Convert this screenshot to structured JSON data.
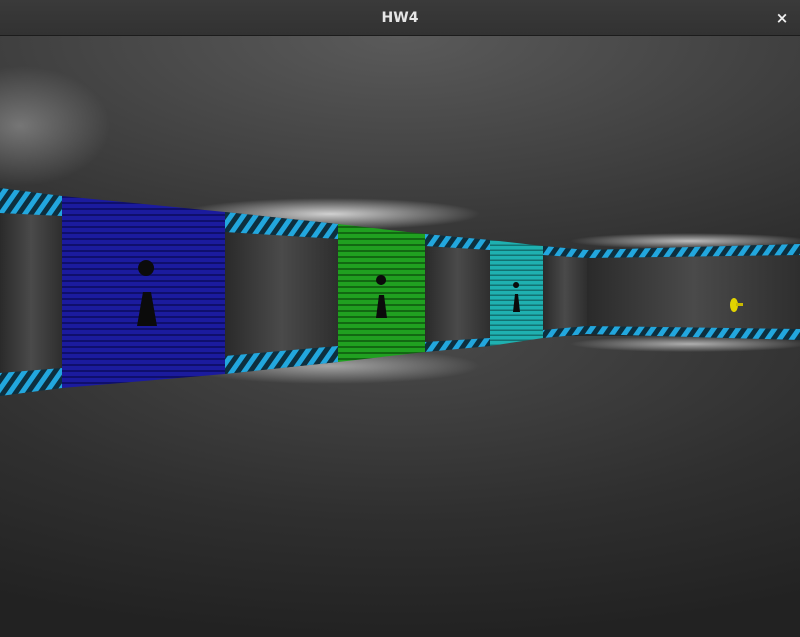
{
  "window": {
    "title": "HW4",
    "close_glyph": "×",
    "close_icon": "close-icon"
  },
  "scene": {
    "description_colors": {
      "wall": "#3b3b3b",
      "stripe_blue": "#1fa3d9",
      "door_blue": "#1a1a9c",
      "door_green": "#1c8f1c",
      "door_cyan": "#1aa3a3",
      "key_yellow": "#e2d400"
    },
    "doors": [
      {
        "name": "blue-door",
        "color": "blue",
        "locked": true
      },
      {
        "name": "green-door",
        "color": "green",
        "locked": true
      },
      {
        "name": "cyan-door",
        "color": "cyan",
        "locked": true
      }
    ],
    "pickups": [
      {
        "name": "yellow-key",
        "color": "yellow"
      }
    ]
  }
}
